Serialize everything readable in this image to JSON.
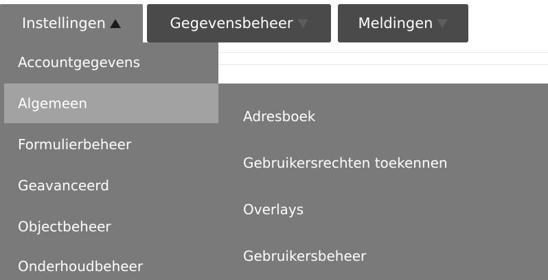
{
  "topnav": {
    "tabs": [
      {
        "label": "Instellingen",
        "arrow": "up"
      },
      {
        "label": "Gegevensbeheer",
        "arrow": "down"
      },
      {
        "label": "Meldingen",
        "arrow": "down"
      }
    ]
  },
  "dropdown": {
    "items": [
      {
        "label": "Accountgegevens"
      },
      {
        "label": "Algemeen",
        "active": true
      },
      {
        "label": "Formulierbeheer"
      },
      {
        "label": "Geavanceerd"
      },
      {
        "label": "Objectbeheer"
      },
      {
        "label": "Onderhoudbeheer"
      }
    ]
  },
  "submenu": {
    "items": [
      {
        "label": "Adresboek"
      },
      {
        "label": "Gebruikersrechten toekennen"
      },
      {
        "label": "Overlays"
      },
      {
        "label": "Gebruikersbeheer"
      }
    ]
  },
  "colors": {
    "menu_bg": "#7a7a7a",
    "active_item_bg": "#a2a2a2",
    "tab_dark_bg": "#4a4a4a",
    "text": "#ffffff"
  }
}
